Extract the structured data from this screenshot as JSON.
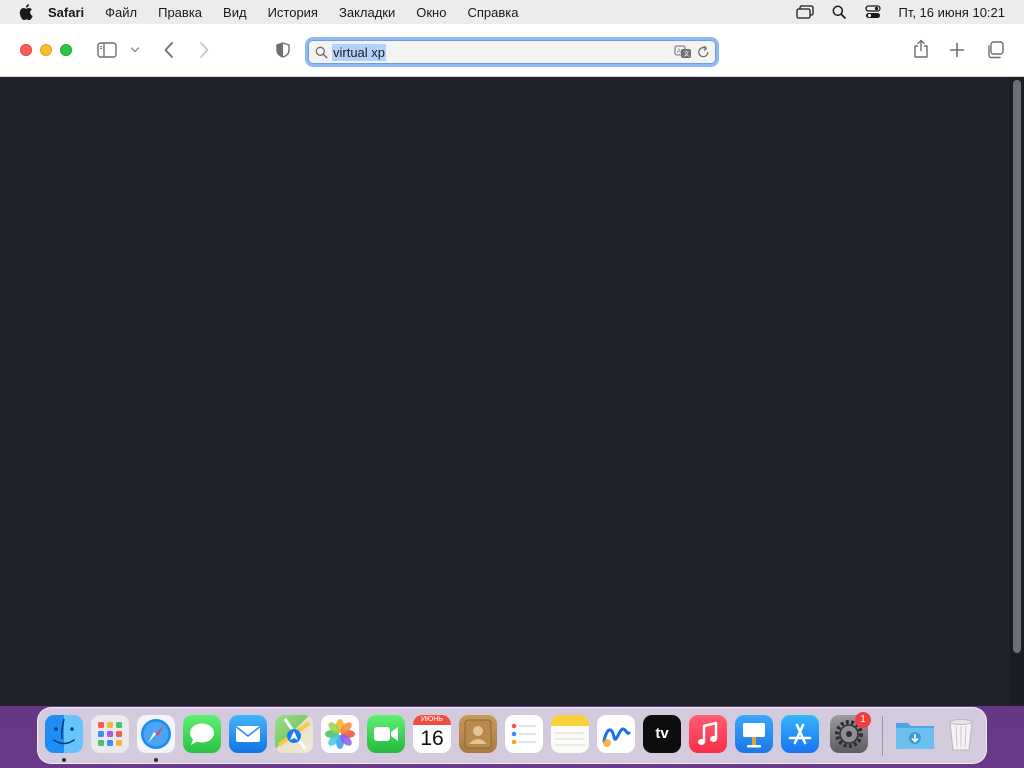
{
  "menubar": {
    "app_name": "Safari",
    "items": [
      "Файл",
      "Правка",
      "Вид",
      "История",
      "Закладки",
      "Окно",
      "Справка"
    ],
    "clock": "Пт, 16 июня  10:21"
  },
  "toolbar": {
    "search_query": "virtual xp"
  },
  "dock": {
    "calendar_month": "ИЮНЬ",
    "calendar_day": "16",
    "tv_label": "tv",
    "settings_badge": "1"
  },
  "colors": {
    "content_bg": "#1f222b",
    "accent": "#8fb8f2"
  }
}
